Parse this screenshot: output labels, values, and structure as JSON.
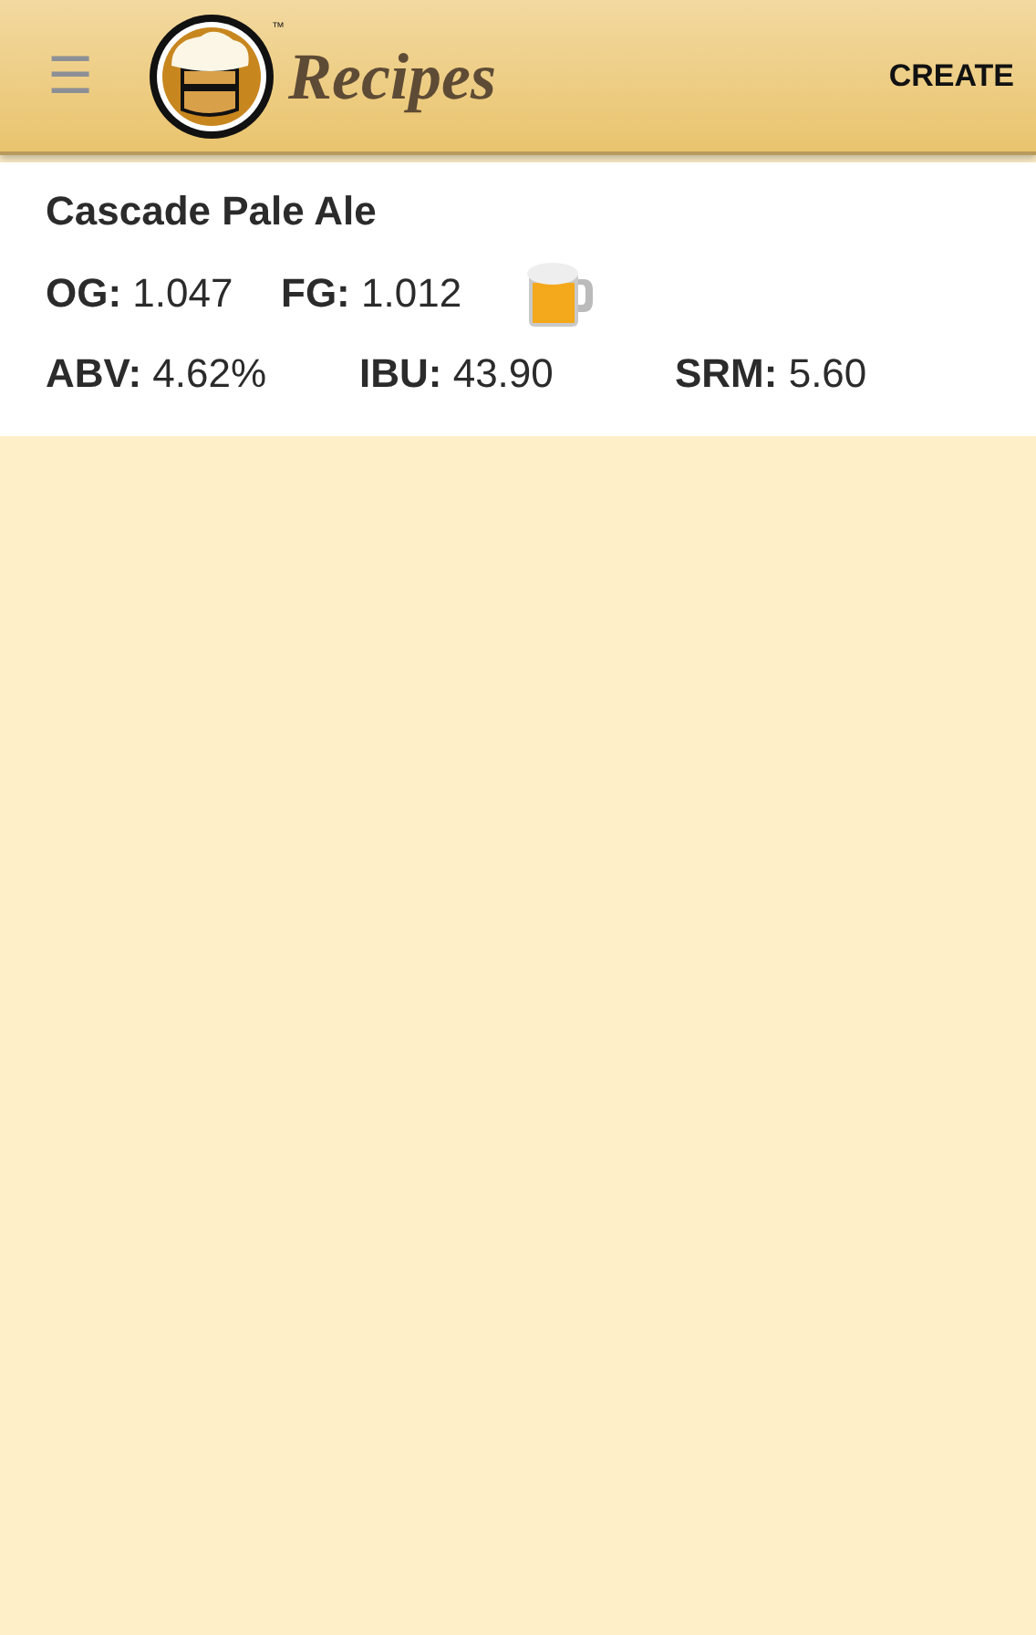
{
  "app_bar": {
    "menu_icon": "☰",
    "title": "Recipes",
    "trademark": "™",
    "action": "CREATE"
  },
  "recipes": [
    {
      "name": "Cascade Pale Ale",
      "gravity": [
        "**OG:** 1.047",
        "**FG:** 1.012"
      ],
      "stats": [
        "**ABV:** 4.62%",
        "**IBU:** 43.90",
        "**SRM:** 5.60"
      ]
    }
  ]
}
